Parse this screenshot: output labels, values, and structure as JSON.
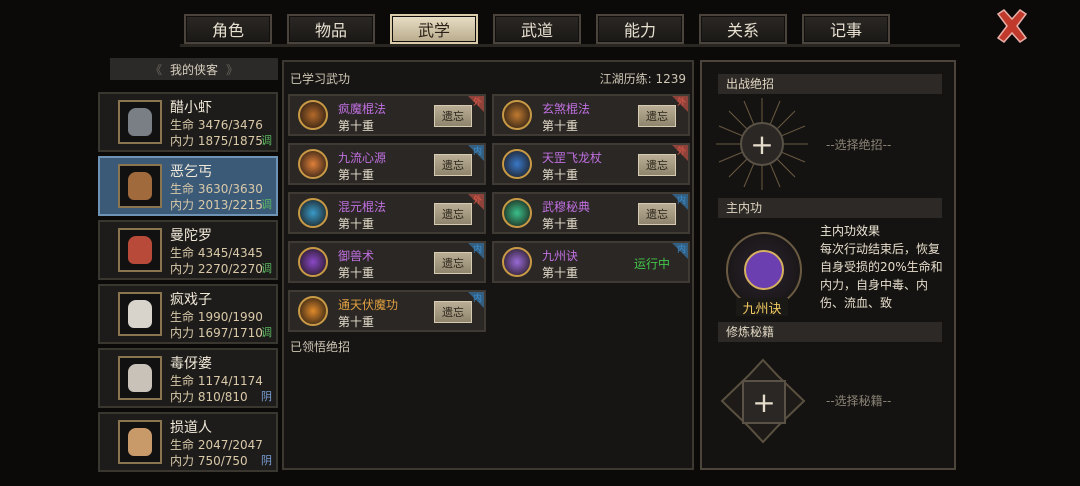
{
  "tabs": [
    "角色",
    "物品",
    "武学",
    "武道",
    "能力",
    "关系",
    "记事"
  ],
  "active_tab": 2,
  "left": {
    "title": "我的侠客",
    "heroes": [
      {
        "name": "醋小虾",
        "hp": "生命 3476/3476",
        "mp": "内力 1875/1875",
        "tag": "调",
        "tag_color": "#5cb862",
        "face": "#7a7f86"
      },
      {
        "name": "恶乞丐",
        "hp": "生命 3630/3630",
        "mp": "内力 2013/2215",
        "tag": "调",
        "tag_color": "#5cb862",
        "face": "#a06a3c"
      },
      {
        "name": "曼陀罗",
        "hp": "生命 4345/4345",
        "mp": "内力 2270/2270",
        "tag": "调",
        "tag_color": "#5cb862",
        "face": "#b84a3a"
      },
      {
        "name": "疯戏子",
        "hp": "生命 1990/1990",
        "mp": "内力 1697/1710",
        "tag": "调",
        "tag_color": "#5cb862",
        "face": "#d8d4cc"
      },
      {
        "name": "毒伢婆",
        "hp": "生命 1174/1174",
        "mp": "内力 810/810",
        "tag": "阴",
        "tag_color": "#7aa0d8",
        "face": "#c8c2b8"
      },
      {
        "name": "损道人",
        "hp": "生命 2047/2047",
        "mp": "内力 750/750",
        "tag": "阴",
        "tag_color": "#7aa0d8",
        "face": "#c89a6a"
      }
    ]
  },
  "center": {
    "learned_title": "已学习武功",
    "experience": "江湖历练: 1239",
    "comprehended_title": "已领悟绝招",
    "skills": [
      {
        "name": "疯魔棍法",
        "level": "第十重",
        "action": "遗忘",
        "corner": "外",
        "name_color": "#c070e0",
        "icon_color": "#b46a2a"
      },
      {
        "name": "玄煞棍法",
        "level": "第十重",
        "action": "遗忘",
        "corner": "外",
        "name_color": "#c070e0",
        "icon_color": "#c07a30"
      },
      {
        "name": "九流心源",
        "level": "第十重",
        "action": "遗忘",
        "corner": "内",
        "name_color": "#c070e0",
        "icon_color": "#e0803a"
      },
      {
        "name": "天罡飞龙杖",
        "level": "第十重",
        "action": "遗忘",
        "corner": "外",
        "name_color": "#c070e0",
        "icon_color": "#3a78c8"
      },
      {
        "name": "混元棍法",
        "level": "第十重",
        "action": "遗忘",
        "corner": "外",
        "name_color": "#c070e0",
        "icon_color": "#3a9ac8"
      },
      {
        "name": "武穆秘典",
        "level": "第十重",
        "action": "遗忘",
        "corner": "内",
        "name_color": "#c070e0",
        "icon_color": "#3ac08a"
      },
      {
        "name": "御兽术",
        "level": "第十重",
        "action": "遗忘",
        "corner": "内",
        "name_color": "#c070e0",
        "icon_color": "#8a48c8"
      },
      {
        "name": "九州诀",
        "level": "第十重",
        "action": "运行中",
        "corner": "内",
        "name_color": "#c070e0",
        "icon_color": "#9a6ad8"
      },
      {
        "name": "通天伏魔功",
        "level": "第十重",
        "action": "遗忘",
        "corner": "内",
        "name_color": "#e0a040",
        "icon_color": "#e08a2a"
      }
    ]
  },
  "right": {
    "battle_title": "出战绝招",
    "battle_hint": "--选择绝招--",
    "main_title": "主内功",
    "main_effect_title": "主内功效果",
    "main_effect_text": "每次行动结束后，恢复自身受损的20%生命和内力，自身中毒、内伤、流血、致",
    "main_skill_name": "九州诀",
    "manual_title": "修炼秘籍",
    "manual_hint": "--选择秘籍--",
    "plus": "+"
  },
  "colors": {
    "outer": "#e05a4a",
    "inner": "#3a8ed0"
  }
}
